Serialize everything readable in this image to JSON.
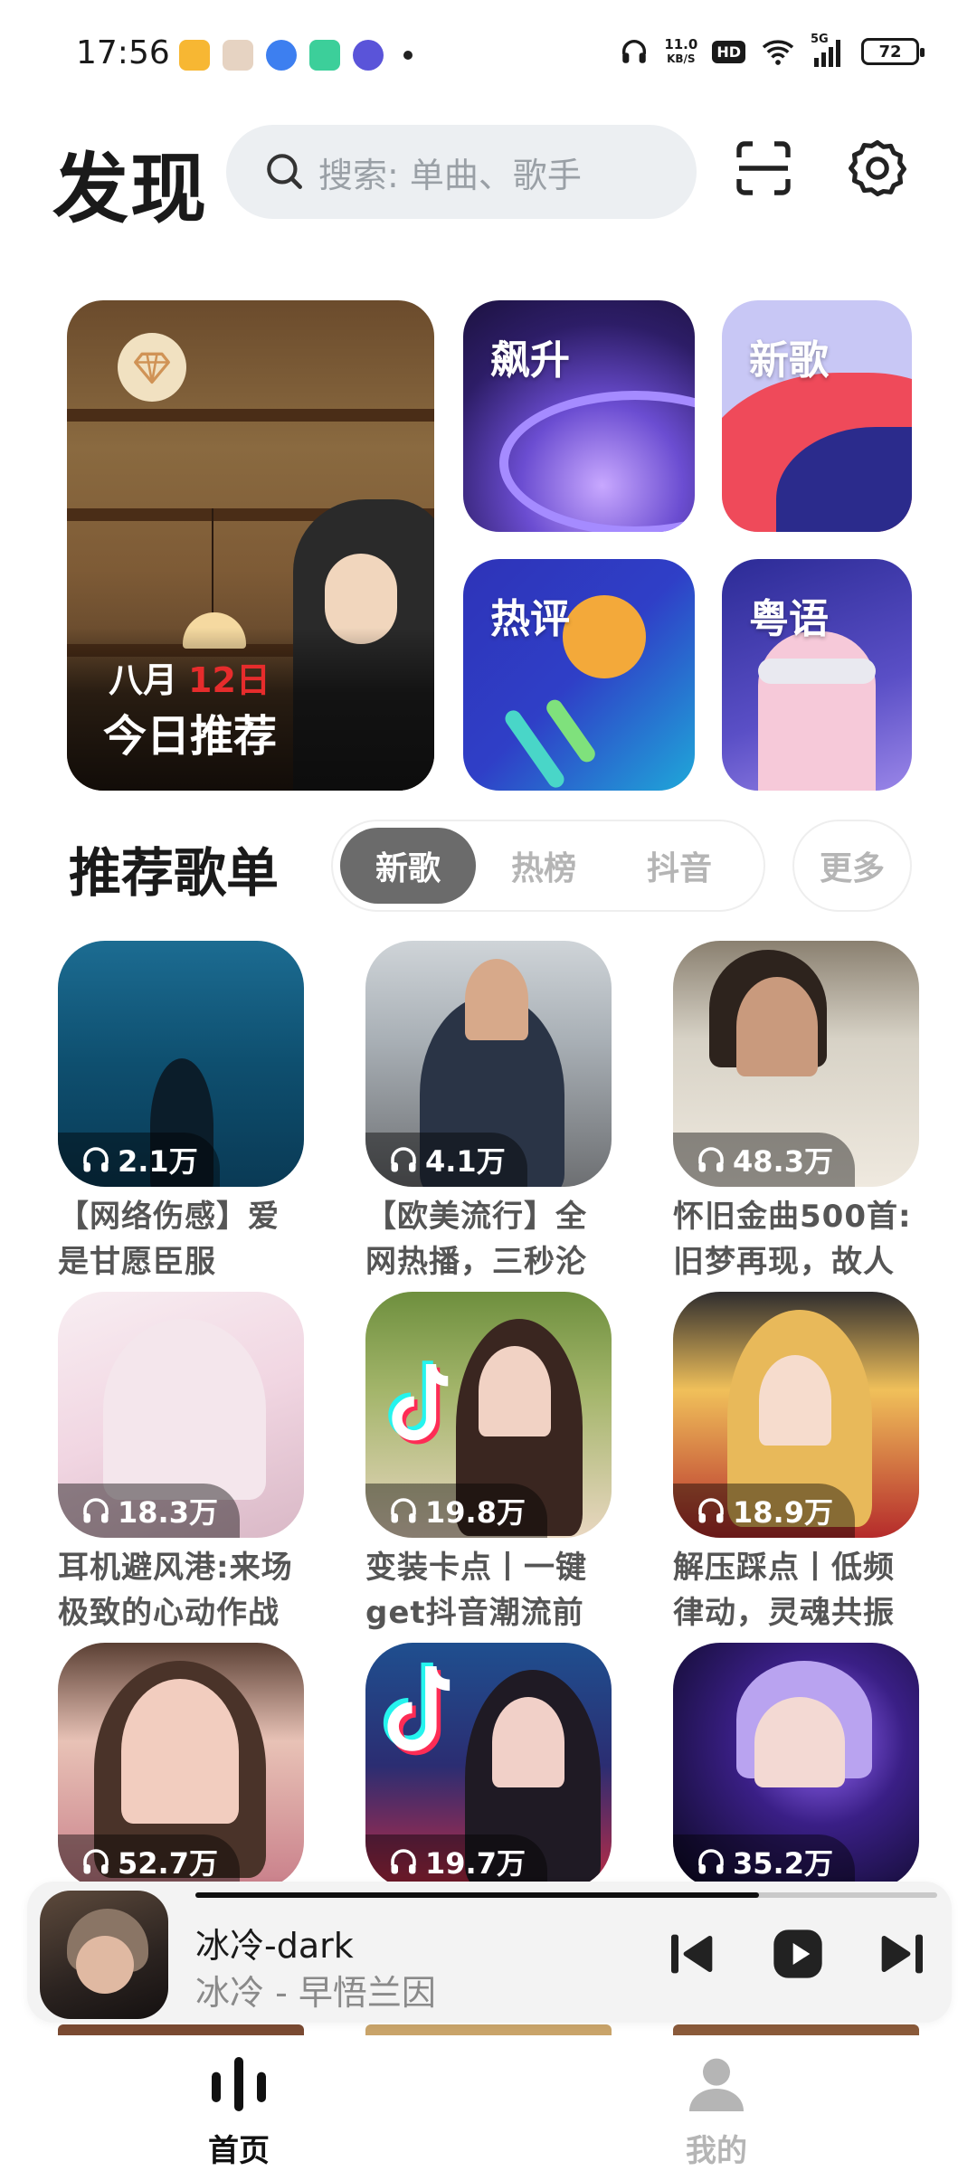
{
  "status_bar": {
    "time": "17:56",
    "net_speed_value": "11.0",
    "net_speed_unit": "KB/S",
    "hd": "HD",
    "signal": "5G",
    "battery": "72"
  },
  "header": {
    "title": "发现",
    "search_placeholder": "搜索: 单曲、歌手"
  },
  "banners": {
    "daily": {
      "month": "八月",
      "day": "12日",
      "label": "今日推荐"
    },
    "soaring": "飙升",
    "new_songs": "新歌",
    "hot_comments": "热评",
    "cantonese": "粤语"
  },
  "playlists": {
    "section_title": "推荐歌单",
    "tabs": [
      "新歌",
      "热榜",
      "抖音"
    ],
    "active_tab": 0,
    "more": "更多",
    "items": [
      {
        "plays": "2.1万",
        "title": "【网络伤感】爱是甘愿臣服"
      },
      {
        "plays": "4.1万",
        "title": "【欧美流行】全网热播，三秒沦"
      },
      {
        "plays": "48.3万",
        "title": "怀旧金曲500首:旧梦再现，故人"
      },
      {
        "plays": "18.3万",
        "title": "耳机避风港:来场极致的心动作战"
      },
      {
        "plays": "19.8万",
        "title": "变装卡点丨一键get抖音潮流前线"
      },
      {
        "plays": "18.9万",
        "title": "解压踩点丨低频律动，灵魂共振"
      },
      {
        "plays": "52.7万",
        "title": ""
      },
      {
        "plays": "19.7万",
        "title": ""
      },
      {
        "plays": "35.2万",
        "title": ""
      }
    ]
  },
  "player": {
    "title": "冰冷-dark",
    "artist": "冰冷 - 早悟兰因",
    "progress": 0.76
  },
  "bottom_nav": {
    "items": [
      {
        "label": "首页",
        "active": true,
        "icon": "sound-bars-icon"
      },
      {
        "label": "我的",
        "active": false,
        "icon": "user-icon"
      }
    ]
  },
  "colors": {
    "accent_red": "#e62c2c",
    "tab_active_bg": "#6b6b6b",
    "search_bg": "#eceff2"
  }
}
